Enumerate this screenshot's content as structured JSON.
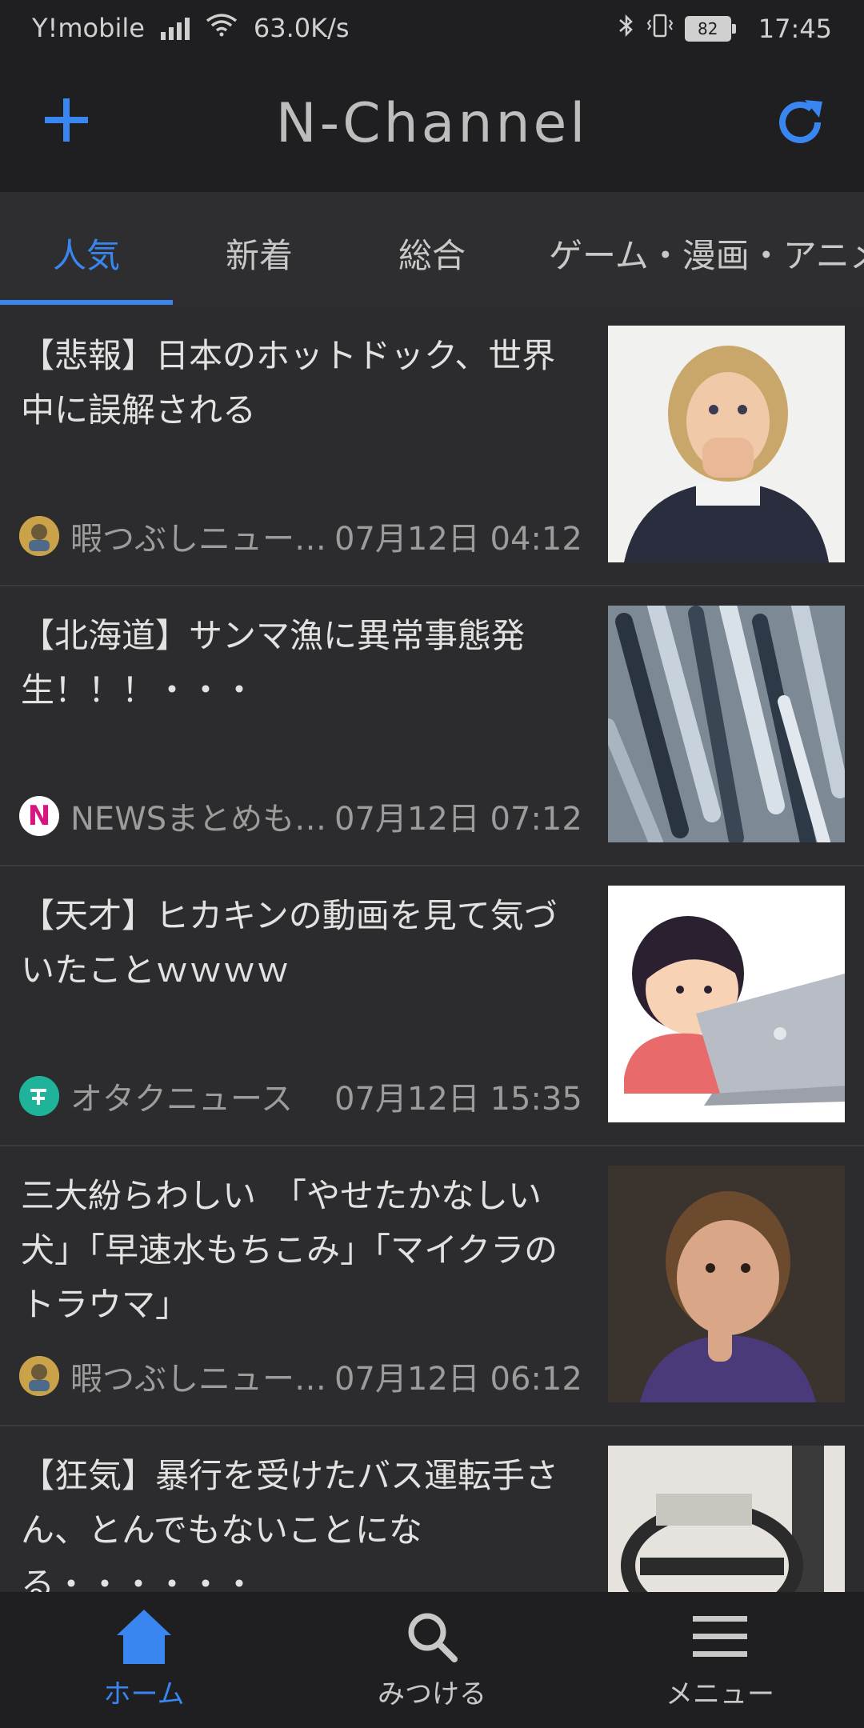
{
  "status_bar": {
    "carrier": "Y!mobile",
    "speed": "63.0K/s",
    "battery": "82",
    "time": "17:45"
  },
  "app_bar": {
    "title": "N-Channel"
  },
  "tabs": [
    {
      "label": "人気",
      "active": true
    },
    {
      "label": "新着",
      "active": false
    },
    {
      "label": "総合",
      "active": false
    },
    {
      "label": "ゲーム・漫画・アニメ",
      "active": false
    }
  ],
  "articles": [
    {
      "title": "【悲報】日本のホットドック、世界中に誤解される",
      "source": "暇つぶしニュー…",
      "date": "07月12日 04:12"
    },
    {
      "title": "【北海道】サンマ漁に異常事態発生！！！・・・",
      "source": "NEWSまとめも…",
      "date": "07月12日 07:12"
    },
    {
      "title": "【天才】ヒカキンの動画を見て気づいたことｗｗｗｗ",
      "source": "オタクニュース",
      "date": "07月12日 15:35"
    },
    {
      "title": "三大紛らわしい　「やせたかなしい犬」「早速水もちこみ」「マイクラのトラウマ」",
      "source": "暇つぶしニュー…",
      "date": "07月12日 06:12"
    },
    {
      "title": "【狂気】暴行を受けたバス運転手さん、とんでもないことになる・・・・・・",
      "source": "",
      "date": ""
    }
  ],
  "source_icons": {
    "news_n": "N"
  },
  "bottom_nav": [
    {
      "label": "ホーム",
      "icon": "home-icon",
      "active": true
    },
    {
      "label": "みつける",
      "icon": "search-icon",
      "active": false
    },
    {
      "label": "メニュー",
      "icon": "menu-icon",
      "active": false
    }
  ],
  "colors": {
    "accent": "#3a86f0",
    "background": "#2c2c2e",
    "bar": "#1f1f21"
  }
}
